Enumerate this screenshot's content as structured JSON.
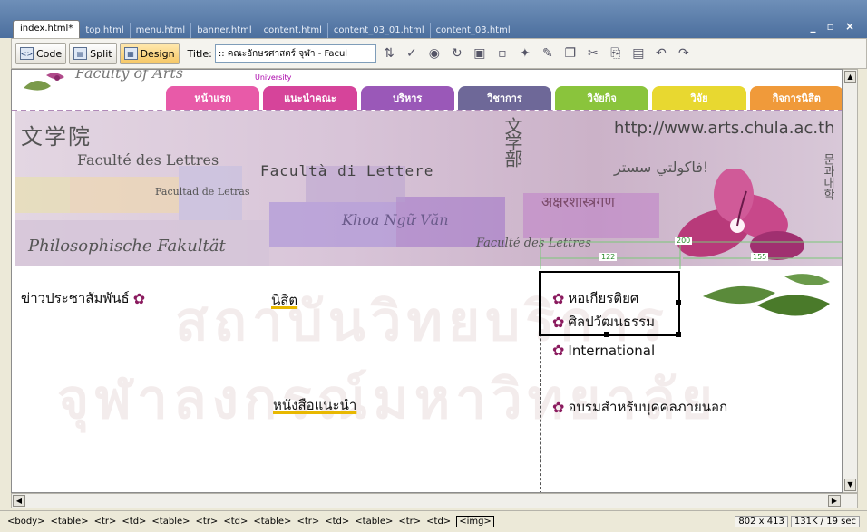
{
  "tabs": [
    {
      "label": "index.html*",
      "active": true
    },
    {
      "label": "top.html"
    },
    {
      "label": "menu.html"
    },
    {
      "label": "banner.html"
    },
    {
      "label": "content.html",
      "underlined": true
    },
    {
      "label": "content_03_01.html"
    },
    {
      "label": "content_03.html"
    }
  ],
  "window_controls": "_ ▫ ×",
  "toolbar": {
    "code_label": "Code",
    "split_label": "Split",
    "design_label": "Design",
    "title_label": "Title:",
    "title_value": ":: คณะอักษรศาสตร์ จุฬา - Facul"
  },
  "page_header": {
    "logo_text": "Faculty of Arts",
    "university_text": "University"
  },
  "nav": [
    {
      "label": "หน้าแรก",
      "color": "#e85aa8"
    },
    {
      "label": "แนะนำคณะ",
      "color": "#d6449a"
    },
    {
      "label": "บริหาร",
      "color": "#9a58b8"
    },
    {
      "label": "วิชาการ",
      "color": "#6e6898"
    },
    {
      "label": "วิจัยกิจ",
      "color": "#8ac43c"
    },
    {
      "label": "วิจัย",
      "color": "#e8d830"
    },
    {
      "label": "กิจการนิสิต",
      "color": "#f09a3a"
    }
  ],
  "banner": {
    "chinese": "文学院",
    "french": "Faculté des Lettres",
    "italian": "Facultà di Lettere",
    "spanish": "Facultad de Letras",
    "german": "Philosophische Fakultät",
    "vietnamese": "Khoa Ngữ Văn",
    "japanese": "文学部",
    "url": "http://www.arts.chula.ac.th",
    "arabic": "فاكولتي سستر!",
    "sanskrit": "अक्षरशास्त्रगण",
    "korean": "문과대학",
    "faculte": "Faculté des Lettres"
  },
  "dimensions": {
    "top": "200",
    "left": "122",
    "right": "155"
  },
  "content": {
    "news": "ข่าวประชาสัมพันธ์",
    "student": "นิสิต",
    "books": "หนังสือแนะนำ",
    "honor": "หอเกียรติยศ",
    "art": "ศิลปวัฒนธรรม",
    "international": "International",
    "training": "อบรมสำหรับบุคคลภายนอก"
  },
  "watermark": {
    "line1": "สถาบันวิทยบริการ",
    "line2": "จุฬาลงกรณ์มหาวิทยาลัย"
  },
  "breadcrumbs": [
    "<body>",
    "<table>",
    "<tr>",
    "<td>",
    "<table>",
    "<tr>",
    "<td>",
    "<table>",
    "<tr>",
    "<td>",
    "<table>",
    "<tr>",
    "<td>",
    "<img>"
  ],
  "status": {
    "size": "802 x 413",
    "filesize": "131K / 19 sec"
  }
}
